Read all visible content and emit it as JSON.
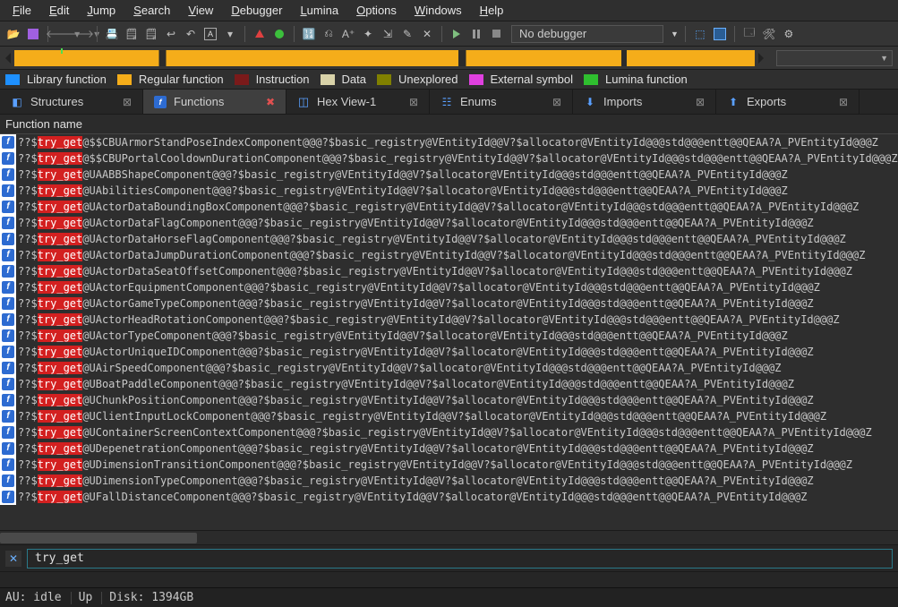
{
  "menu": {
    "items": [
      "File",
      "Edit",
      "Jump",
      "Search",
      "View",
      "Debugger",
      "Lumina",
      "Options",
      "Windows",
      "Help"
    ]
  },
  "toolbar": {
    "debugger_label": "No debugger"
  },
  "legend": {
    "items": [
      {
        "color": "#1e90ff",
        "label": "Library function"
      },
      {
        "color": "#f5ad1a",
        "label": "Regular function"
      },
      {
        "color": "#7a1a1a",
        "label": "Instruction"
      },
      {
        "color": "#d8d2a8",
        "label": "Data"
      },
      {
        "color": "#808000",
        "label": "Unexplored"
      },
      {
        "color": "#e040e0",
        "label": "External symbol"
      },
      {
        "color": "#2fbf2f",
        "label": "Lumina function"
      }
    ]
  },
  "tabs": [
    {
      "icon": "struct",
      "label": "Structures",
      "active": false
    },
    {
      "icon": "func",
      "label": "Functions",
      "active": true
    },
    {
      "icon": "hex",
      "label": "Hex View-1",
      "active": false
    },
    {
      "icon": "enum",
      "label": "Enums",
      "active": false
    },
    {
      "icon": "imp",
      "label": "Imports",
      "active": false
    },
    {
      "icon": "exp",
      "label": "Exports",
      "active": false
    }
  ],
  "list": {
    "header": "Function name",
    "highlight": "try_get",
    "rows": [
      "@$$CBUArmorStandPoseIndexComponent@@@?$basic_registry@VEntityId@@V?$allocator@VEntityId@@@std@@@entt@@QEAA?A_PVEntityId@@@Z",
      "@$$CBUPortalCooldownDurationComponent@@@?$basic_registry@VEntityId@@V?$allocator@VEntityId@@@std@@@entt@@QEAA?A_PVEntityId@@@Z",
      "@UAABBShapeComponent@@@?$basic_registry@VEntityId@@V?$allocator@VEntityId@@@std@@@entt@@QEAA?A_PVEntityId@@@Z",
      "@UAbilitiesComponent@@@?$basic_registry@VEntityId@@V?$allocator@VEntityId@@@std@@@entt@@QEAA?A_PVEntityId@@@Z",
      "@UActorDataBoundingBoxComponent@@@?$basic_registry@VEntityId@@V?$allocator@VEntityId@@@std@@@entt@@QEAA?A_PVEntityId@@@Z",
      "@UActorDataFlagComponent@@@?$basic_registry@VEntityId@@V?$allocator@VEntityId@@@std@@@entt@@QEAA?A_PVEntityId@@@Z",
      "@UActorDataHorseFlagComponent@@@?$basic_registry@VEntityId@@V?$allocator@VEntityId@@@std@@@entt@@QEAA?A_PVEntityId@@@Z",
      "@UActorDataJumpDurationComponent@@@?$basic_registry@VEntityId@@V?$allocator@VEntityId@@@std@@@entt@@QEAA?A_PVEntityId@@@Z",
      "@UActorDataSeatOffsetComponent@@@?$basic_registry@VEntityId@@V?$allocator@VEntityId@@@std@@@entt@@QEAA?A_PVEntityId@@@Z",
      "@UActorEquipmentComponent@@@?$basic_registry@VEntityId@@V?$allocator@VEntityId@@@std@@@entt@@QEAA?A_PVEntityId@@@Z",
      "@UActorGameTypeComponent@@@?$basic_registry@VEntityId@@V?$allocator@VEntityId@@@std@@@entt@@QEAA?A_PVEntityId@@@Z",
      "@UActorHeadRotationComponent@@@?$basic_registry@VEntityId@@V?$allocator@VEntityId@@@std@@@entt@@QEAA?A_PVEntityId@@@Z",
      "@UActorTypeComponent@@@?$basic_registry@VEntityId@@V?$allocator@VEntityId@@@std@@@entt@@QEAA?A_PVEntityId@@@Z",
      "@UActorUniqueIDComponent@@@?$basic_registry@VEntityId@@V?$allocator@VEntityId@@@std@@@entt@@QEAA?A_PVEntityId@@@Z",
      "@UAirSpeedComponent@@@?$basic_registry@VEntityId@@V?$allocator@VEntityId@@@std@@@entt@@QEAA?A_PVEntityId@@@Z",
      "@UBoatPaddleComponent@@@?$basic_registry@VEntityId@@V?$allocator@VEntityId@@@std@@@entt@@QEAA?A_PVEntityId@@@Z",
      "@UChunkPositionComponent@@@?$basic_registry@VEntityId@@V?$allocator@VEntityId@@@std@@@entt@@QEAA?A_PVEntityId@@@Z",
      "@UClientInputLockComponent@@@?$basic_registry@VEntityId@@V?$allocator@VEntityId@@@std@@@entt@@QEAA?A_PVEntityId@@@Z",
      "@UContainerScreenContextComponent@@@?$basic_registry@VEntityId@@V?$allocator@VEntityId@@@std@@@entt@@QEAA?A_PVEntityId@@@Z",
      "@UDepenetrationComponent@@@?$basic_registry@VEntityId@@V?$allocator@VEntityId@@@std@@@entt@@QEAA?A_PVEntityId@@@Z",
      "@UDimensionTransitionComponent@@@?$basic_registry@VEntityId@@V?$allocator@VEntityId@@@std@@@entt@@QEAA?A_PVEntityId@@@Z",
      "@UDimensionTypeComponent@@@?$basic_registry@VEntityId@@V?$allocator@VEntityId@@@std@@@entt@@QEAA?A_PVEntityId@@@Z",
      "@UFallDistanceComponent@@@?$basic_registry@VEntityId@@V?$allocator@VEntityId@@@std@@@entt@@QEAA?A_PVEntityId@@@Z"
    ],
    "prefix": "??$"
  },
  "filter": {
    "value": "try_get"
  },
  "status": {
    "au": "AU:  idle",
    "up": "Up",
    "disk": "Disk: 1394GB"
  }
}
